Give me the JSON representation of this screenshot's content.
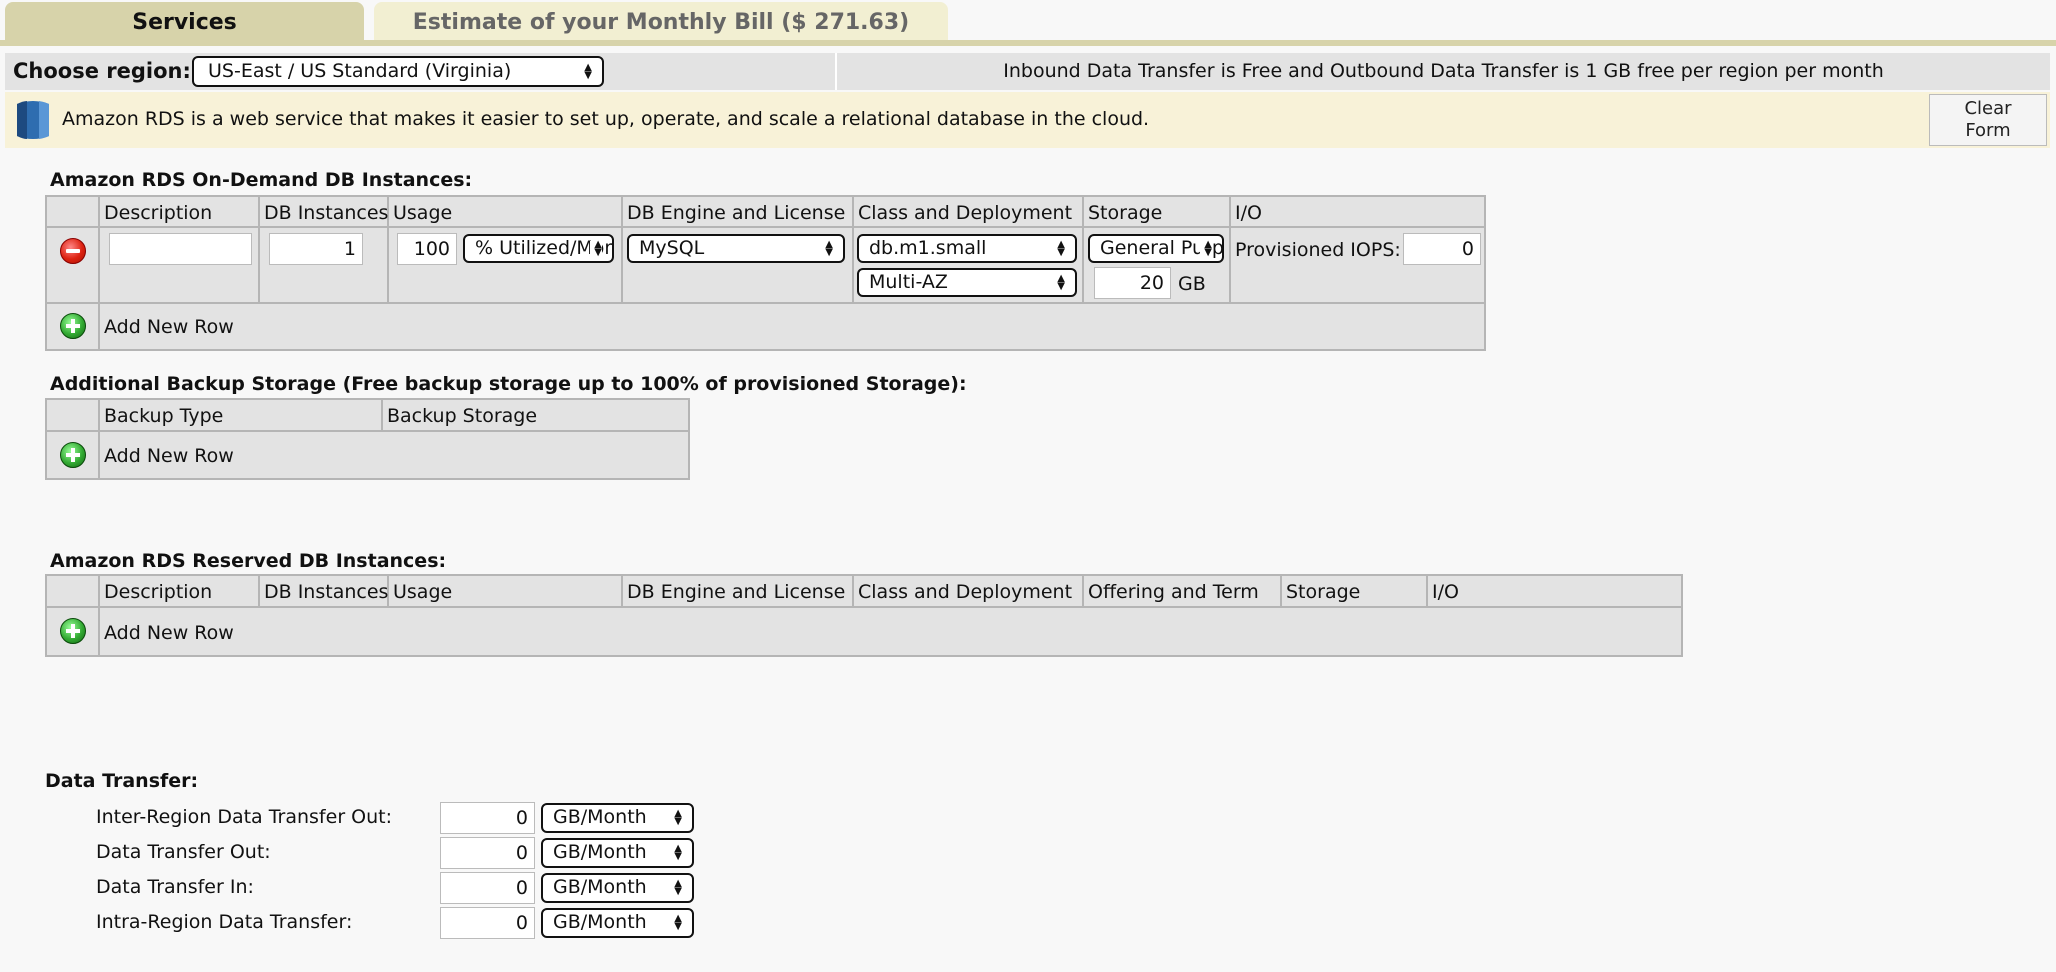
{
  "tabs": {
    "services": "Services",
    "estimate": "Estimate of your Monthly Bill ($ 271.63)"
  },
  "region": {
    "label": "Choose region:",
    "selected": "US-East / US Standard (Virginia)",
    "info": "Inbound Data Transfer is Free and Outbound Data Transfer is 1 GB free per region per month"
  },
  "notice": {
    "text": "Amazon RDS is a web service that makes it easier to set up, operate, and scale a relational database in the cloud.",
    "clear_line1": "Clear",
    "clear_line2": "Form"
  },
  "ondemand": {
    "title": "Amazon RDS On-Demand DB Instances:",
    "headers": [
      "Description",
      "DB Instances",
      "Usage",
      "DB Engine and License",
      "Class and Deployment",
      "Storage",
      "I/O"
    ],
    "row": {
      "description": "",
      "instances": "1",
      "usage_value": "100",
      "usage_unit": "% Utilized/Month",
      "engine": "MySQL",
      "class": "db.m1.small",
      "deployment": "Multi-AZ",
      "storage_type": "General Purpose",
      "storage_size": "20",
      "storage_unit": "GB",
      "iops_label": "Provisioned IOPS:",
      "iops_value": "0"
    },
    "add_row": "Add New Row"
  },
  "backup": {
    "title": "Additional Backup Storage (Free backup storage up to 100% of provisioned Storage):",
    "headers": [
      "Backup Type",
      "Backup Storage"
    ],
    "add_row": "Add New Row"
  },
  "reserved": {
    "title": "Amazon RDS Reserved DB Instances:",
    "headers": [
      "Description",
      "DB Instances",
      "Usage",
      "DB Engine and License",
      "Class and Deployment",
      "Offering and Term",
      "Storage",
      "I/O"
    ],
    "add_row": "Add New Row"
  },
  "transfer": {
    "title": "Data Transfer:",
    "rows": [
      {
        "label": "Inter-Region Data Transfer Out:",
        "value": "0",
        "unit": "GB/Month"
      },
      {
        "label": "Data Transfer Out:",
        "value": "0",
        "unit": "GB/Month"
      },
      {
        "label": "Data Transfer In:",
        "value": "0",
        "unit": "GB/Month"
      },
      {
        "label": "Intra-Region Data Transfer:",
        "value": "0",
        "unit": "GB/Month"
      }
    ]
  }
}
